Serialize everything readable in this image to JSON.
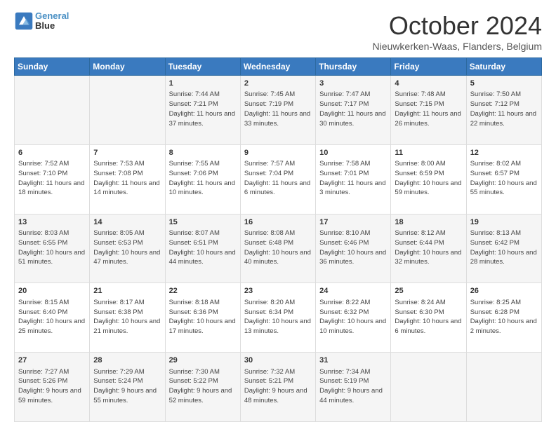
{
  "logo": {
    "line1": "General",
    "line2": "Blue"
  },
  "header": {
    "month": "October 2024",
    "location": "Nieuwkerken-Waas, Flanders, Belgium"
  },
  "days_of_week": [
    "Sunday",
    "Monday",
    "Tuesday",
    "Wednesday",
    "Thursday",
    "Friday",
    "Saturday"
  ],
  "weeks": [
    [
      {
        "day": "",
        "sunrise": "",
        "sunset": "",
        "daylight": ""
      },
      {
        "day": "",
        "sunrise": "",
        "sunset": "",
        "daylight": ""
      },
      {
        "day": "1",
        "sunrise": "Sunrise: 7:44 AM",
        "sunset": "Sunset: 7:21 PM",
        "daylight": "Daylight: 11 hours and 37 minutes."
      },
      {
        "day": "2",
        "sunrise": "Sunrise: 7:45 AM",
        "sunset": "Sunset: 7:19 PM",
        "daylight": "Daylight: 11 hours and 33 minutes."
      },
      {
        "day": "3",
        "sunrise": "Sunrise: 7:47 AM",
        "sunset": "Sunset: 7:17 PM",
        "daylight": "Daylight: 11 hours and 30 minutes."
      },
      {
        "day": "4",
        "sunrise": "Sunrise: 7:48 AM",
        "sunset": "Sunset: 7:15 PM",
        "daylight": "Daylight: 11 hours and 26 minutes."
      },
      {
        "day": "5",
        "sunrise": "Sunrise: 7:50 AM",
        "sunset": "Sunset: 7:12 PM",
        "daylight": "Daylight: 11 hours and 22 minutes."
      }
    ],
    [
      {
        "day": "6",
        "sunrise": "Sunrise: 7:52 AM",
        "sunset": "Sunset: 7:10 PM",
        "daylight": "Daylight: 11 hours and 18 minutes."
      },
      {
        "day": "7",
        "sunrise": "Sunrise: 7:53 AM",
        "sunset": "Sunset: 7:08 PM",
        "daylight": "Daylight: 11 hours and 14 minutes."
      },
      {
        "day": "8",
        "sunrise": "Sunrise: 7:55 AM",
        "sunset": "Sunset: 7:06 PM",
        "daylight": "Daylight: 11 hours and 10 minutes."
      },
      {
        "day": "9",
        "sunrise": "Sunrise: 7:57 AM",
        "sunset": "Sunset: 7:04 PM",
        "daylight": "Daylight: 11 hours and 6 minutes."
      },
      {
        "day": "10",
        "sunrise": "Sunrise: 7:58 AM",
        "sunset": "Sunset: 7:01 PM",
        "daylight": "Daylight: 11 hours and 3 minutes."
      },
      {
        "day": "11",
        "sunrise": "Sunrise: 8:00 AM",
        "sunset": "Sunset: 6:59 PM",
        "daylight": "Daylight: 10 hours and 59 minutes."
      },
      {
        "day": "12",
        "sunrise": "Sunrise: 8:02 AM",
        "sunset": "Sunset: 6:57 PM",
        "daylight": "Daylight: 10 hours and 55 minutes."
      }
    ],
    [
      {
        "day": "13",
        "sunrise": "Sunrise: 8:03 AM",
        "sunset": "Sunset: 6:55 PM",
        "daylight": "Daylight: 10 hours and 51 minutes."
      },
      {
        "day": "14",
        "sunrise": "Sunrise: 8:05 AM",
        "sunset": "Sunset: 6:53 PM",
        "daylight": "Daylight: 10 hours and 47 minutes."
      },
      {
        "day": "15",
        "sunrise": "Sunrise: 8:07 AM",
        "sunset": "Sunset: 6:51 PM",
        "daylight": "Daylight: 10 hours and 44 minutes."
      },
      {
        "day": "16",
        "sunrise": "Sunrise: 8:08 AM",
        "sunset": "Sunset: 6:48 PM",
        "daylight": "Daylight: 10 hours and 40 minutes."
      },
      {
        "day": "17",
        "sunrise": "Sunrise: 8:10 AM",
        "sunset": "Sunset: 6:46 PM",
        "daylight": "Daylight: 10 hours and 36 minutes."
      },
      {
        "day": "18",
        "sunrise": "Sunrise: 8:12 AM",
        "sunset": "Sunset: 6:44 PM",
        "daylight": "Daylight: 10 hours and 32 minutes."
      },
      {
        "day": "19",
        "sunrise": "Sunrise: 8:13 AM",
        "sunset": "Sunset: 6:42 PM",
        "daylight": "Daylight: 10 hours and 28 minutes."
      }
    ],
    [
      {
        "day": "20",
        "sunrise": "Sunrise: 8:15 AM",
        "sunset": "Sunset: 6:40 PM",
        "daylight": "Daylight: 10 hours and 25 minutes."
      },
      {
        "day": "21",
        "sunrise": "Sunrise: 8:17 AM",
        "sunset": "Sunset: 6:38 PM",
        "daylight": "Daylight: 10 hours and 21 minutes."
      },
      {
        "day": "22",
        "sunrise": "Sunrise: 8:18 AM",
        "sunset": "Sunset: 6:36 PM",
        "daylight": "Daylight: 10 hours and 17 minutes."
      },
      {
        "day": "23",
        "sunrise": "Sunrise: 8:20 AM",
        "sunset": "Sunset: 6:34 PM",
        "daylight": "Daylight: 10 hours and 13 minutes."
      },
      {
        "day": "24",
        "sunrise": "Sunrise: 8:22 AM",
        "sunset": "Sunset: 6:32 PM",
        "daylight": "Daylight: 10 hours and 10 minutes."
      },
      {
        "day": "25",
        "sunrise": "Sunrise: 8:24 AM",
        "sunset": "Sunset: 6:30 PM",
        "daylight": "Daylight: 10 hours and 6 minutes."
      },
      {
        "day": "26",
        "sunrise": "Sunrise: 8:25 AM",
        "sunset": "Sunset: 6:28 PM",
        "daylight": "Daylight: 10 hours and 2 minutes."
      }
    ],
    [
      {
        "day": "27",
        "sunrise": "Sunrise: 7:27 AM",
        "sunset": "Sunset: 5:26 PM",
        "daylight": "Daylight: 9 hours and 59 minutes."
      },
      {
        "day": "28",
        "sunrise": "Sunrise: 7:29 AM",
        "sunset": "Sunset: 5:24 PM",
        "daylight": "Daylight: 9 hours and 55 minutes."
      },
      {
        "day": "29",
        "sunrise": "Sunrise: 7:30 AM",
        "sunset": "Sunset: 5:22 PM",
        "daylight": "Daylight: 9 hours and 52 minutes."
      },
      {
        "day": "30",
        "sunrise": "Sunrise: 7:32 AM",
        "sunset": "Sunset: 5:21 PM",
        "daylight": "Daylight: 9 hours and 48 minutes."
      },
      {
        "day": "31",
        "sunrise": "Sunrise: 7:34 AM",
        "sunset": "Sunset: 5:19 PM",
        "daylight": "Daylight: 9 hours and 44 minutes."
      },
      {
        "day": "",
        "sunrise": "",
        "sunset": "",
        "daylight": ""
      },
      {
        "day": "",
        "sunrise": "",
        "sunset": "",
        "daylight": ""
      }
    ]
  ]
}
